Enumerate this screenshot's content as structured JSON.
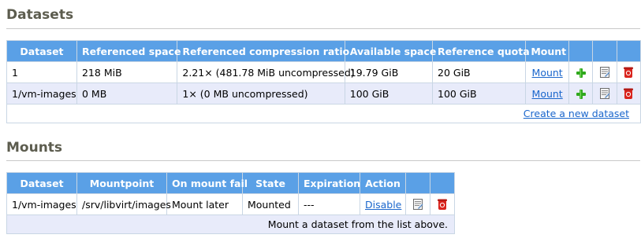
{
  "datasets": {
    "title": "Datasets",
    "columns": [
      "Dataset",
      "Referenced space",
      "Referenced compression ratio",
      "Available space",
      "Reference quota",
      "Mount"
    ],
    "rows": [
      {
        "dataset": "1",
        "referenced_space": "218 MiB",
        "compression_ratio": "2.21× (481.78 MiB uncompressed)",
        "available_space": "19.79 GiB",
        "reference_quota": "20 GiB",
        "mount_label": "Mount"
      },
      {
        "dataset": "1/vm-images",
        "referenced_space": "0 MB",
        "compression_ratio": "1× (0 MB uncompressed)",
        "available_space": "100 GiB",
        "reference_quota": "100 GiB",
        "mount_label": "Mount"
      }
    ],
    "footer_link": "Create a new dataset"
  },
  "mounts": {
    "title": "Mounts",
    "columns": [
      "Dataset",
      "Mountpoint",
      "On mount fail",
      "State",
      "Expiration",
      "Action"
    ],
    "rows": [
      {
        "dataset": "1/vm-images",
        "mountpoint": "/srv/libvirt/images",
        "on_mount_fail": "Mount later",
        "state": "Mounted",
        "expiration": "---",
        "action_label": "Disable"
      }
    ],
    "footer_text": "Mount a dataset from the list above."
  },
  "icons": {
    "add": "plus-icon",
    "edit": "edit-document-icon",
    "delete": "trash-icon"
  },
  "colors": {
    "header_bg": "#5aa0e6",
    "row_alt_bg": "#e8ebfa",
    "link": "#1a66cc",
    "title": "#5c5c4e"
  }
}
